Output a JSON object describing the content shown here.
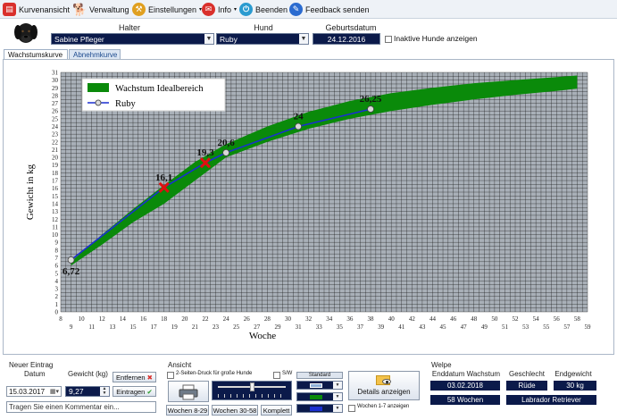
{
  "toolbar": {
    "items": [
      {
        "label": "Kurvenansicht",
        "icon": "chart-icon",
        "color": "#d9302c"
      },
      {
        "label": "Verwaltung",
        "icon": "dog-icon",
        "color": "#111111"
      },
      {
        "label": "Einstellungen",
        "icon": "tools-icon",
        "color": "#e0a020"
      },
      {
        "label": "Info",
        "icon": "info-icon",
        "color": "#d9302c"
      },
      {
        "label": "Beenden",
        "icon": "power-icon",
        "color": "#2a9bd0"
      },
      {
        "label": "Feedback senden",
        "icon": "feedback-icon",
        "color": "#2a6bd0"
      }
    ]
  },
  "header": {
    "owner_label": "Halter",
    "owner_value": "Sabine Pfleger",
    "dog_label": "Hund",
    "dog_value": "Ruby",
    "birth_label": "Geburtsdatum",
    "birth_value": "24.12.2016",
    "inactive_label": "Inaktive Hunde anzeigen"
  },
  "tabs": [
    {
      "label": "Wachstumskurve",
      "active": true
    },
    {
      "label": "Abnehmkurve",
      "active": false
    }
  ],
  "chart_data": {
    "type": "line",
    "xlabel": "Woche",
    "ylabel": "Gewicht in kg",
    "xlim": [
      8,
      59
    ],
    "ylim": [
      0,
      31
    ],
    "x_ticks_upper": [
      8,
      10,
      12,
      14,
      16,
      18,
      20,
      22,
      24,
      26,
      28,
      30,
      32,
      34,
      36,
      38,
      40,
      42,
      44,
      46,
      48,
      50,
      52,
      54,
      56,
      58
    ],
    "x_ticks_lower": [
      9,
      11,
      13,
      15,
      17,
      19,
      21,
      23,
      25,
      27,
      29,
      31,
      33,
      35,
      37,
      39,
      41,
      43,
      45,
      47,
      49,
      51,
      53,
      55,
      57,
      59
    ],
    "y_ticks": [
      0,
      1,
      2,
      3,
      4,
      5,
      6,
      7,
      8,
      9,
      10,
      11,
      12,
      13,
      14,
      15,
      16,
      17,
      18,
      19,
      20,
      21,
      22,
      23,
      24,
      25,
      26,
      27,
      28,
      29,
      30,
      31
    ],
    "legend": {
      "placement": "top-left",
      "band_label": "Wachstum Idealbereich",
      "series_label": "Ruby"
    },
    "ideal_range": {
      "color": "#0a8a0a",
      "x": [
        9,
        12,
        15,
        18,
        21,
        24,
        28,
        32,
        36,
        40,
        44,
        48,
        52,
        56,
        58
      ],
      "lower": [
        6.0,
        8.7,
        11.6,
        14.0,
        17.0,
        20.0,
        22.0,
        23.7,
        25.0,
        26.0,
        26.8,
        27.5,
        28.1,
        28.6,
        28.9
      ],
      "upper": [
        6.5,
        10.0,
        13.3,
        16.4,
        19.4,
        21.7,
        24.0,
        25.9,
        27.3,
        28.3,
        29.0,
        29.6,
        30.0,
        30.4,
        30.6
      ]
    },
    "series": [
      {
        "name": "Ruby",
        "color": "#1a2fd0",
        "x": [
          9,
          18,
          22,
          24,
          31,
          38
        ],
        "y": [
          6.72,
          16.1,
          19.3,
          20.6,
          24,
          26.25
        ],
        "labels": [
          "6,72",
          "16,1",
          "19,3",
          "20,6",
          "24",
          "26,25"
        ],
        "markers": [
          "circle",
          "cross",
          "cross",
          "circle",
          "circle",
          "circle"
        ]
      }
    ]
  },
  "new_entry": {
    "title": "Neuer Eintrag",
    "date_label": "Datum",
    "date_value": "15.03.2017",
    "weight_label": "Gewicht (kg)",
    "weight_value": "9,27",
    "remove_label": "Entfernen",
    "add_label": "Eintragen",
    "comment_placeholder": "Tragen Sie einen Kommentar ein..."
  },
  "view": {
    "title": "Ansicht",
    "two_page_label": "2-Seiten-Druck für große Hunde",
    "bw_label": "S/W",
    "standard_label": "Standard",
    "details_label": "Details anzeigen",
    "weeks_1_7_label": "Wochen 1-7 anzeigen",
    "btn_weeks_8_29": "Wochen 8-29",
    "btn_weeks_30_58": "Wochen 30-58",
    "btn_complete": "Komplett",
    "slider_level": 0.5,
    "swatch_colors": [
      "#8fb0d8",
      "#0a8a0a",
      "#1a2fd0"
    ]
  },
  "puppy": {
    "title": "Welpe",
    "end_label": "Enddatum Wachstum",
    "end_value": "03.02.2018",
    "weeks_value": "58 Wochen",
    "sex_label": "Geschlecht",
    "sex_value": "Rüde",
    "final_label": "Endgewicht",
    "final_value": "30 kg",
    "breed_value": "Labrador Retriever"
  }
}
